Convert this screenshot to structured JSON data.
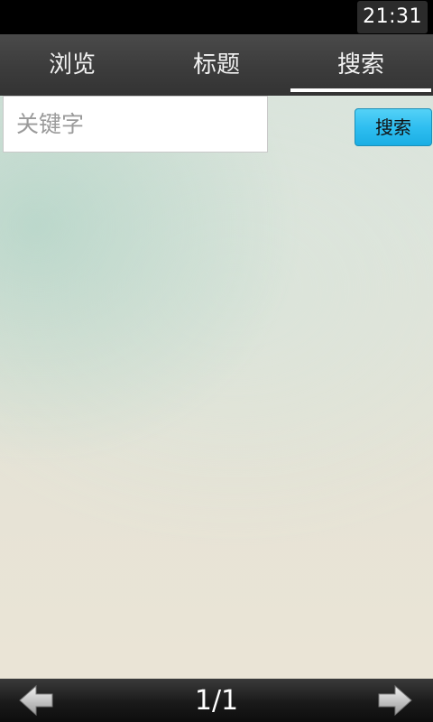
{
  "status_bar": {
    "time": "21:31"
  },
  "tabs": [
    {
      "label": "浏览",
      "selected": false
    },
    {
      "label": "标题",
      "selected": false
    },
    {
      "label": "搜索",
      "selected": true
    }
  ],
  "search": {
    "value": "",
    "placeholder": "关键字",
    "button_label": "搜索"
  },
  "pagination": {
    "label": "1/1",
    "prev_icon": "left-arrow-icon",
    "next_icon": "right-arrow-icon"
  },
  "colors": {
    "accent": "#2fbef0",
    "tab_bar": "#3d3d3d",
    "status_bar": "#000000"
  }
}
